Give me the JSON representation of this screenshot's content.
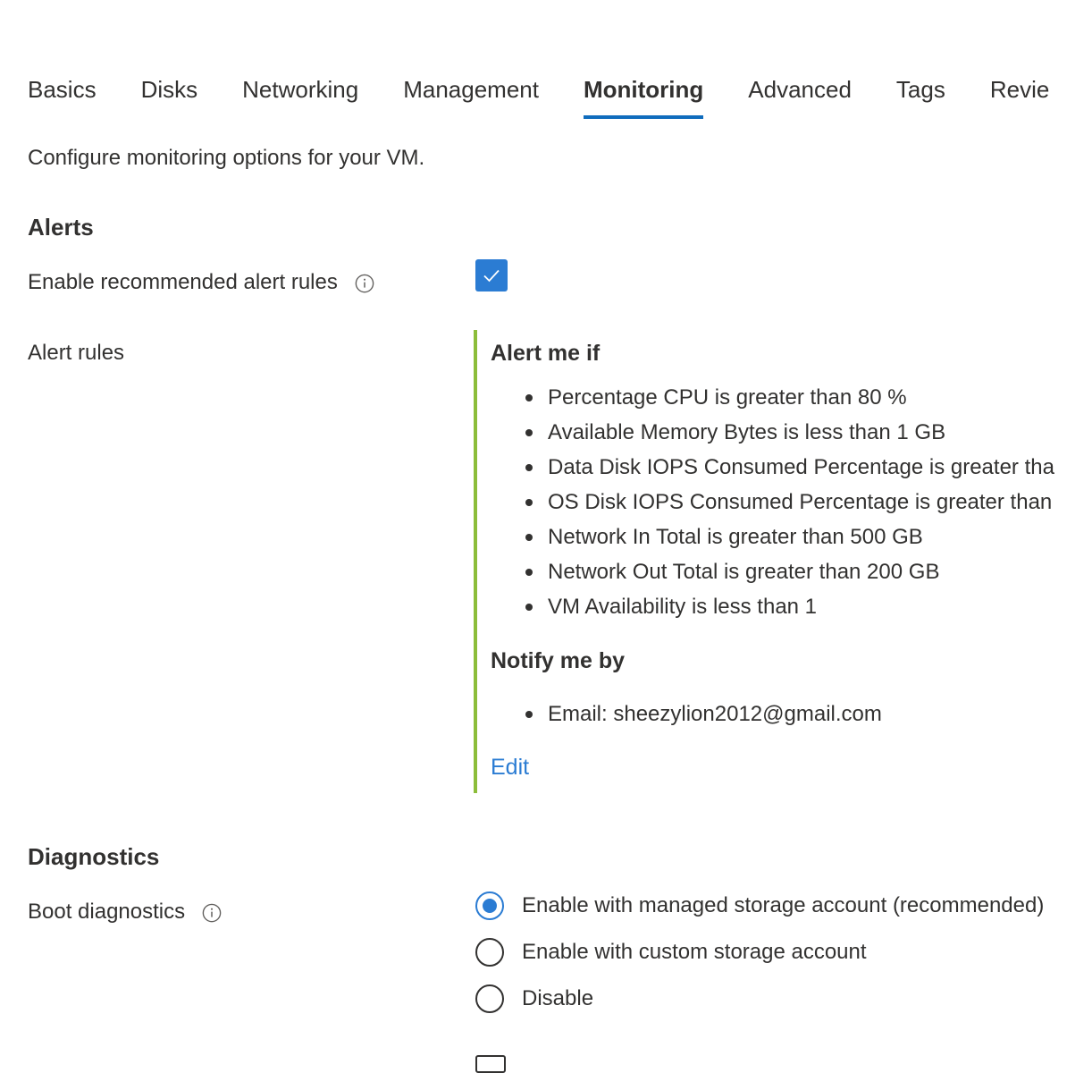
{
  "tabs": [
    {
      "label": "Basics",
      "active": false
    },
    {
      "label": "Disks",
      "active": false
    },
    {
      "label": "Networking",
      "active": false
    },
    {
      "label": "Management",
      "active": false
    },
    {
      "label": "Monitoring",
      "active": true
    },
    {
      "label": "Advanced",
      "active": false
    },
    {
      "label": "Tags",
      "active": false
    },
    {
      "label": "Revie",
      "active": false
    }
  ],
  "intro": "Configure monitoring options for your VM.",
  "alerts": {
    "title": "Alerts",
    "enable_label": "Enable recommended alert rules",
    "enable_checked": true,
    "rules_label": "Alert rules",
    "alert_me_if": "Alert me if",
    "conditions": [
      "Percentage CPU is greater than 80 %",
      "Available Memory Bytes is less than 1 GB",
      "Data Disk IOPS Consumed Percentage is greater tha",
      "OS Disk IOPS Consumed Percentage is greater than",
      "Network In Total is greater than 500 GB",
      "Network Out Total is greater than 200 GB",
      "VM Availability is less than 1"
    ],
    "notify_me_by": "Notify me by",
    "notifications": [
      "Email: sheezylion2012@gmail.com"
    ],
    "edit_label": "Edit"
  },
  "diagnostics": {
    "title": "Diagnostics",
    "boot_label": "Boot diagnostics",
    "options": [
      {
        "label": "Enable with managed storage account (recommended)",
        "selected": true
      },
      {
        "label": "Enable with custom storage account",
        "selected": false
      },
      {
        "label": "Disable",
        "selected": false
      }
    ]
  },
  "colors": {
    "accent": "#2b7cd3",
    "tab_underline": "#0f6cbd",
    "rules_border": "#8cbd3a",
    "text": "#323130"
  },
  "icons": [
    "info-icon",
    "checkmark-icon"
  ]
}
